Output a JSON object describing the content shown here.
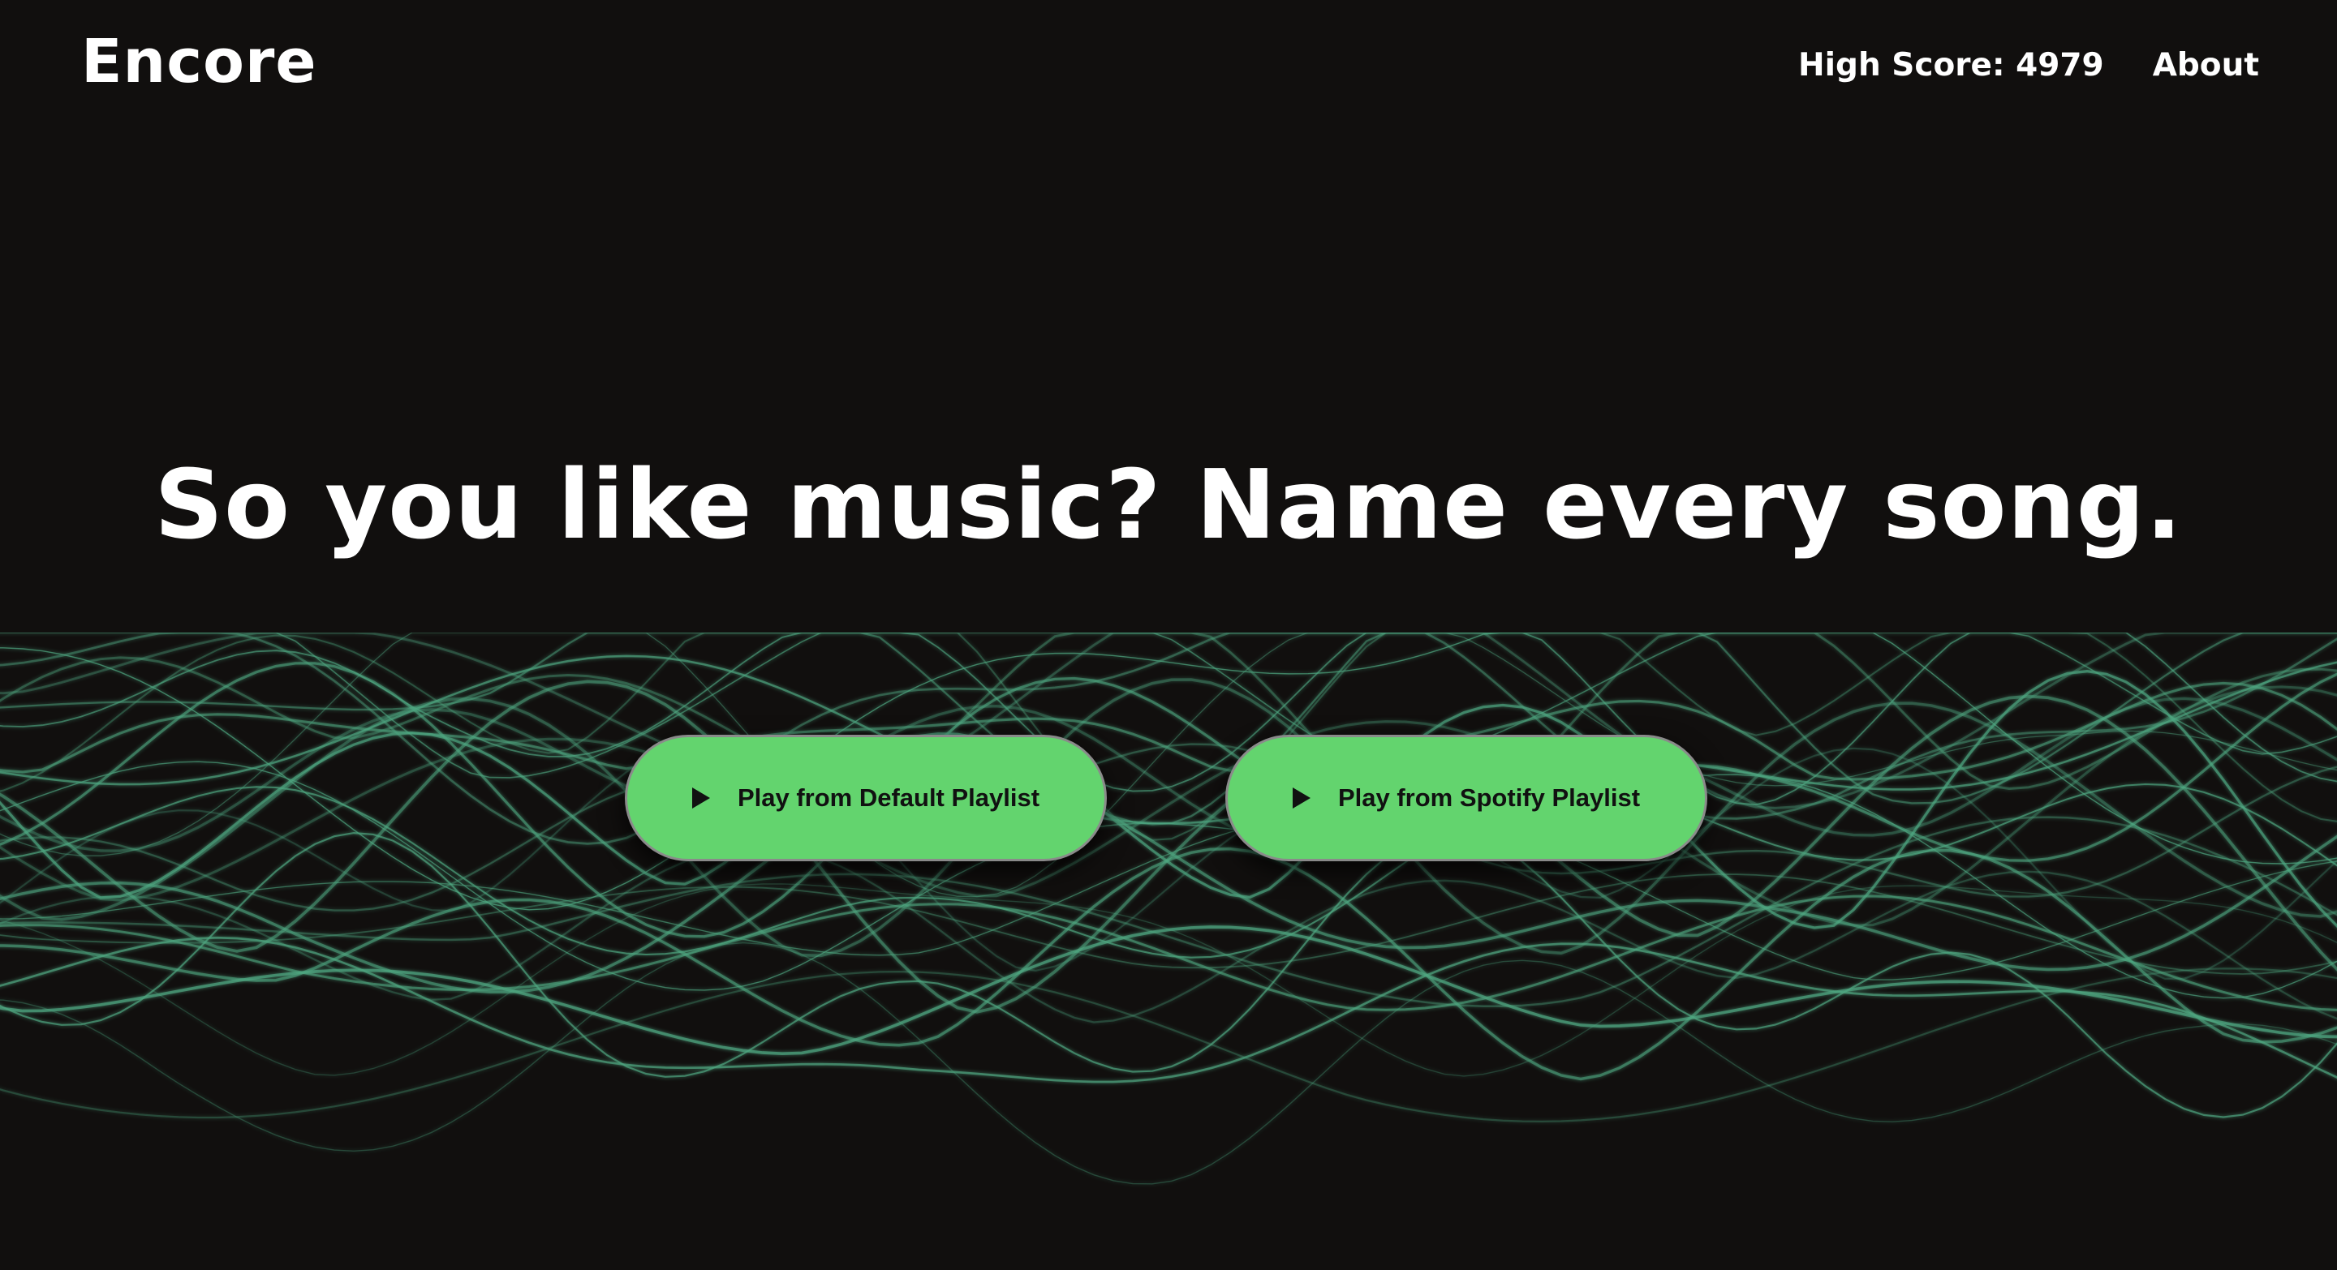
{
  "header": {
    "logo": "Encore",
    "nav": {
      "high_score": "High Score: 4979",
      "about": "About"
    }
  },
  "hero": {
    "title": "So you like music? Name every song."
  },
  "actions": {
    "default_playlist_label": "Play from Default Playlist",
    "spotify_playlist_label": "Play from Spotify Playlist",
    "icon": "play-icon"
  },
  "colors": {
    "background": "#110f0e",
    "accent": "#63d46e",
    "wave": "#4fa882",
    "text": "#ffffff"
  }
}
